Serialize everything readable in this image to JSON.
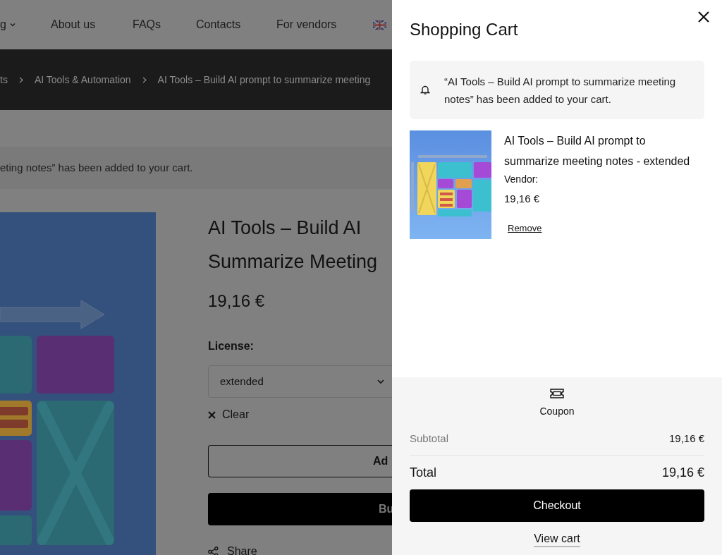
{
  "page": {
    "nav": [
      {
        "label": "g",
        "dropdown": true
      },
      {
        "label": "About us",
        "dropdown": false
      },
      {
        "label": "FAQs",
        "dropdown": false
      },
      {
        "label": "Contacts",
        "dropdown": false
      },
      {
        "label": "For vendors",
        "dropdown": false
      }
    ],
    "breadcrumb": [
      "ts",
      "AI Tools & Automation",
      "AI Tools – Build AI prompt to summarize meeting"
    ],
    "notice": "eting notes” has been added to your cart.",
    "product": {
      "title_lines": [
        "AI Tools – Build AI",
        "Summarize Meeting"
      ],
      "price": "19,16 €",
      "license_label": "License:",
      "license_value": "extended",
      "clear": "Clear",
      "add_button": "Ad",
      "buy_button": "Bu",
      "share": "Share"
    }
  },
  "cart": {
    "title": "Shopping Cart",
    "notice": "“AI Tools – Build AI prompt to summarize meeting notes” has been added to your cart.",
    "items": [
      {
        "name": "AI Tools – Build AI prompt to summarize meeting notes - extended",
        "vendor_label": "Vendor:",
        "price": "19,16 €",
        "remove": "Remove"
      }
    ],
    "coupon": "Coupon",
    "subtotal_label": "Subtotal",
    "subtotal": "19,16 €",
    "total_label": "Total",
    "total": "19,16 €",
    "checkout": "Checkout",
    "view_cart": "View cart"
  }
}
